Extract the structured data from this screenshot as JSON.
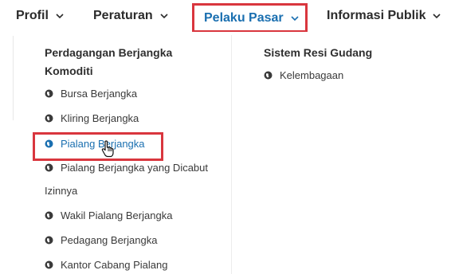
{
  "nav": {
    "profil": "Profil",
    "peraturan": "Peraturan",
    "pelaku_pasar": "Pelaku Pasar",
    "informasi_publik": "Informasi Publik"
  },
  "dropdown": {
    "col1": {
      "heading": "Perdagangan Berjangka Komoditi",
      "items": [
        "Bursa Berjangka",
        "Kliring Berjangka",
        "Pialang Berjangka",
        "Pialang Berjangka yang Dicabut",
        "Wakil Pialang Berjangka",
        "Pedagang Berjangka",
        "Kantor Cabang Pialang"
      ],
      "item3_continuation": "Izinnya",
      "active_item": "Pialang Berjangka"
    },
    "col2": {
      "heading": "Sistem Resi Gudang",
      "items": [
        "Kelembagaan"
      ]
    }
  },
  "colors": {
    "accent_blue": "#1a6fb0",
    "highlight_red": "#d9363e",
    "text_dark": "#2b2b2b"
  },
  "icons": {
    "nav_dropdown": "chevron-down-icon",
    "menu_bullet": "globe-icon",
    "cursor": "hand-pointer-icon"
  }
}
